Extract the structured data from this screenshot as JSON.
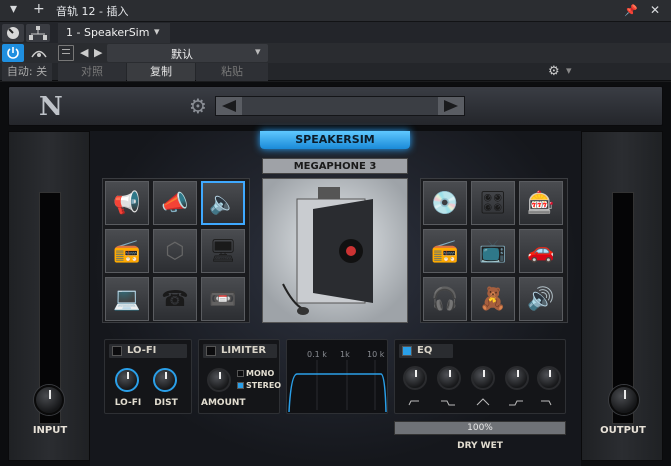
{
  "window": {
    "title": "音轨 12 - 插入",
    "pin_glyph": "📌",
    "close_glyph": "✕",
    "add_glyph": "+"
  },
  "toolbar": {
    "preset_slot": "1 - SpeakerSim",
    "preset_name": "默认",
    "auto_label": "自动: 关",
    "compare_label": "对照",
    "copy_label": "复制",
    "paste_label": "粘贴"
  },
  "plugin": {
    "brand_letter": "N",
    "name": "SPEAKERSIM",
    "model_name": "MEGAPHONE 3",
    "input_label": "INPUT",
    "output_label": "OUTPUT",
    "lofi": {
      "title": "LO-FI",
      "knob1_label": "LO-FI",
      "knob2_label": "DIST"
    },
    "limiter": {
      "title": "LIMITER",
      "knob_label": "AMOUNT",
      "mono_label": "MONO",
      "stereo_label": "STEREO"
    },
    "filter": {
      "ticks": [
        "0.1 k",
        "1k",
        "10 k"
      ]
    },
    "eq": {
      "title": "EQ"
    },
    "dry_wet": {
      "value": "100%",
      "label": "DRY WET",
      "fraction": 1.0
    }
  },
  "colors": {
    "accent": "#2a9fe8",
    "background": "#0c0d0f"
  }
}
